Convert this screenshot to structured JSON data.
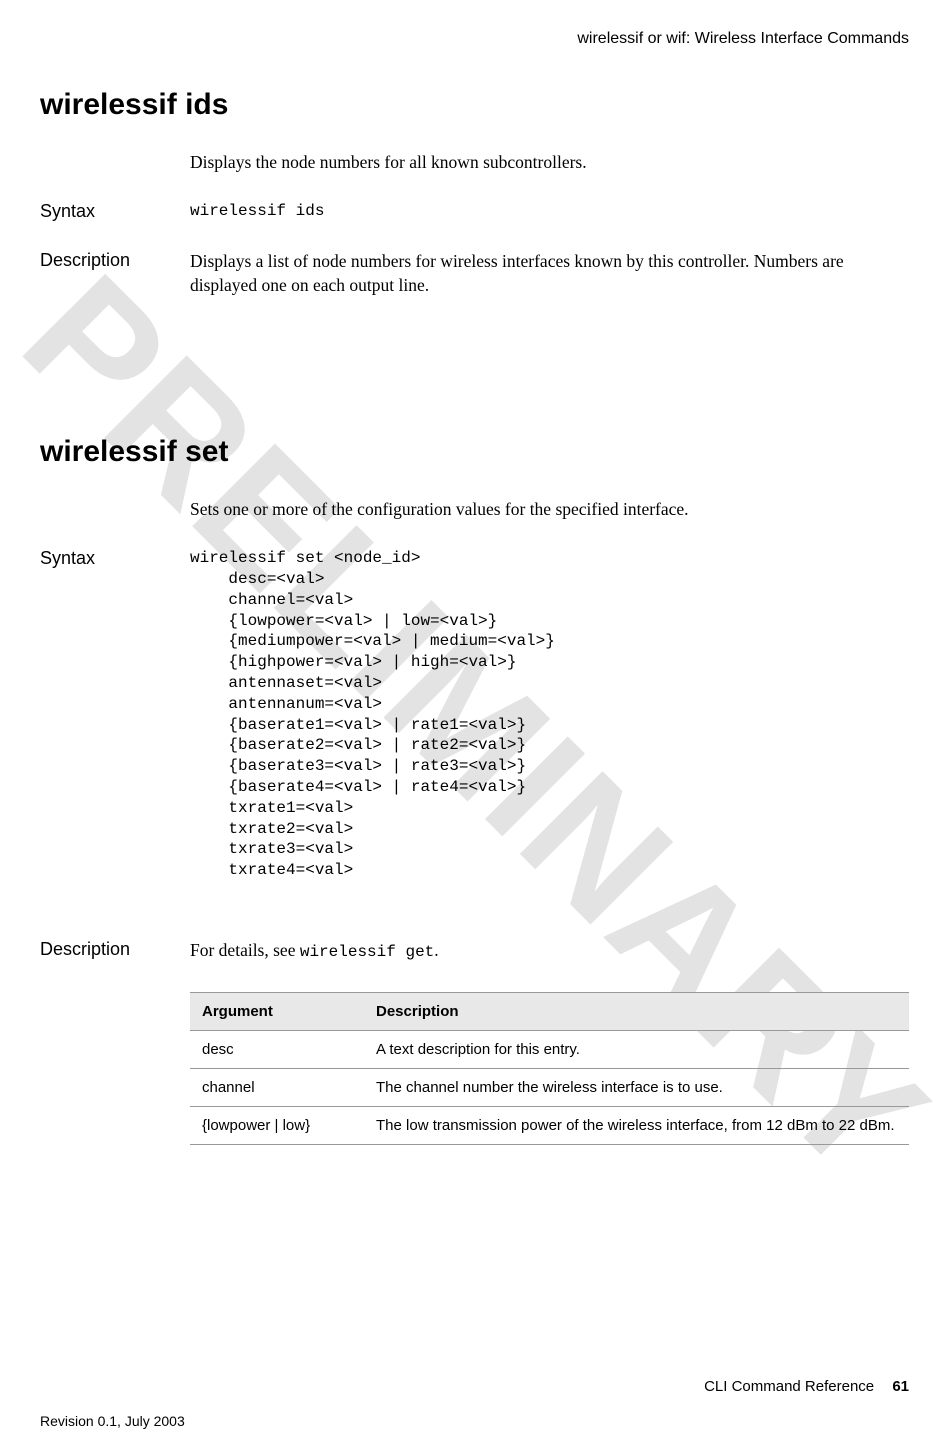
{
  "watermark": "PRELIMINARY",
  "header": {
    "running": "wirelessif or wif: Wireless Interface Commands"
  },
  "sections": [
    {
      "title": "wirelessif ids",
      "intro": "Displays the node numbers for all known subcontrollers.",
      "syntax_label": "Syntax",
      "syntax": "wirelessif ids",
      "description_label": "Description",
      "description": "Displays a list of node numbers for wireless interfaces known by this controller. Numbers are displayed one on each output line."
    },
    {
      "title": "wirelessif set",
      "intro": "Sets one or more of the configuration values for the specified interface.",
      "syntax_label": "Syntax",
      "syntax": "wirelessif set <node_id>\n    desc=<val>\n    channel=<val>\n    {lowpower=<val> | low=<val>}\n    {mediumpower=<val> | medium=<val>}\n    {highpower=<val> | high=<val>}\n    antennaset=<val>\n    antennanum=<val>\n    {baserate1=<val> | rate1=<val>}\n    {baserate2=<val> | rate2=<val>}\n    {baserate3=<val> | rate3=<val>}\n    {baserate4=<val> | rate4=<val>}\n    txrate1=<val>\n    txrate2=<val>\n    txrate3=<val>\n    txrate4=<val>",
      "description_label": "Description",
      "description_prefix": "For details, see ",
      "description_mono": "wirelessif get",
      "description_suffix": ".",
      "table": {
        "headers": [
          "Argument",
          "Description"
        ],
        "rows": [
          [
            "desc",
            "A text description for this entry."
          ],
          [
            "channel",
            "The channel number the wireless interface is to use."
          ],
          [
            "{lowpower | low}",
            "The low transmission power of the wireless interface, from 12 dBm to 22 dBm."
          ]
        ]
      }
    }
  ],
  "footer": {
    "doc_title": "CLI Command Reference",
    "page_number": "61",
    "revision": "Revision 0.1, July 2003"
  }
}
